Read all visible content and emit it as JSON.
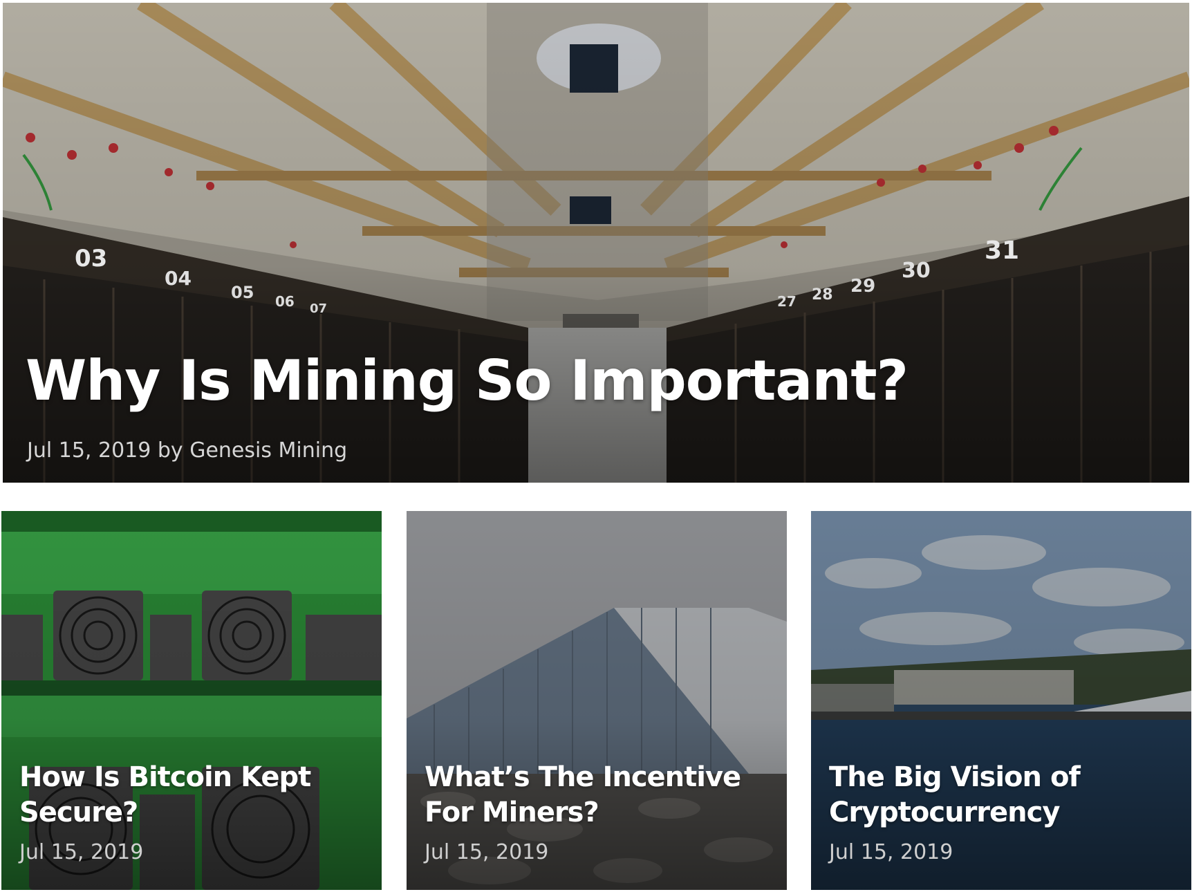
{
  "featured": {
    "title": "Why Is Mining So Important?",
    "meta": "Jul 15, 2019 by Genesis Mining",
    "rack_numbers_left": [
      "03",
      "04",
      "05",
      "06",
      "07"
    ],
    "rack_numbers_right": [
      "27",
      "28",
      "29",
      "30",
      "31"
    ]
  },
  "posts": [
    {
      "title": "How Is Bitcoin Kept Secure?",
      "date": "Jul 15, 2019"
    },
    {
      "title": "What’s The Incentive For Miners?",
      "date": "Jul 15, 2019"
    },
    {
      "title": "The Big Vision of Cryptocurrency",
      "date": "Jul 15, 2019"
    }
  ]
}
